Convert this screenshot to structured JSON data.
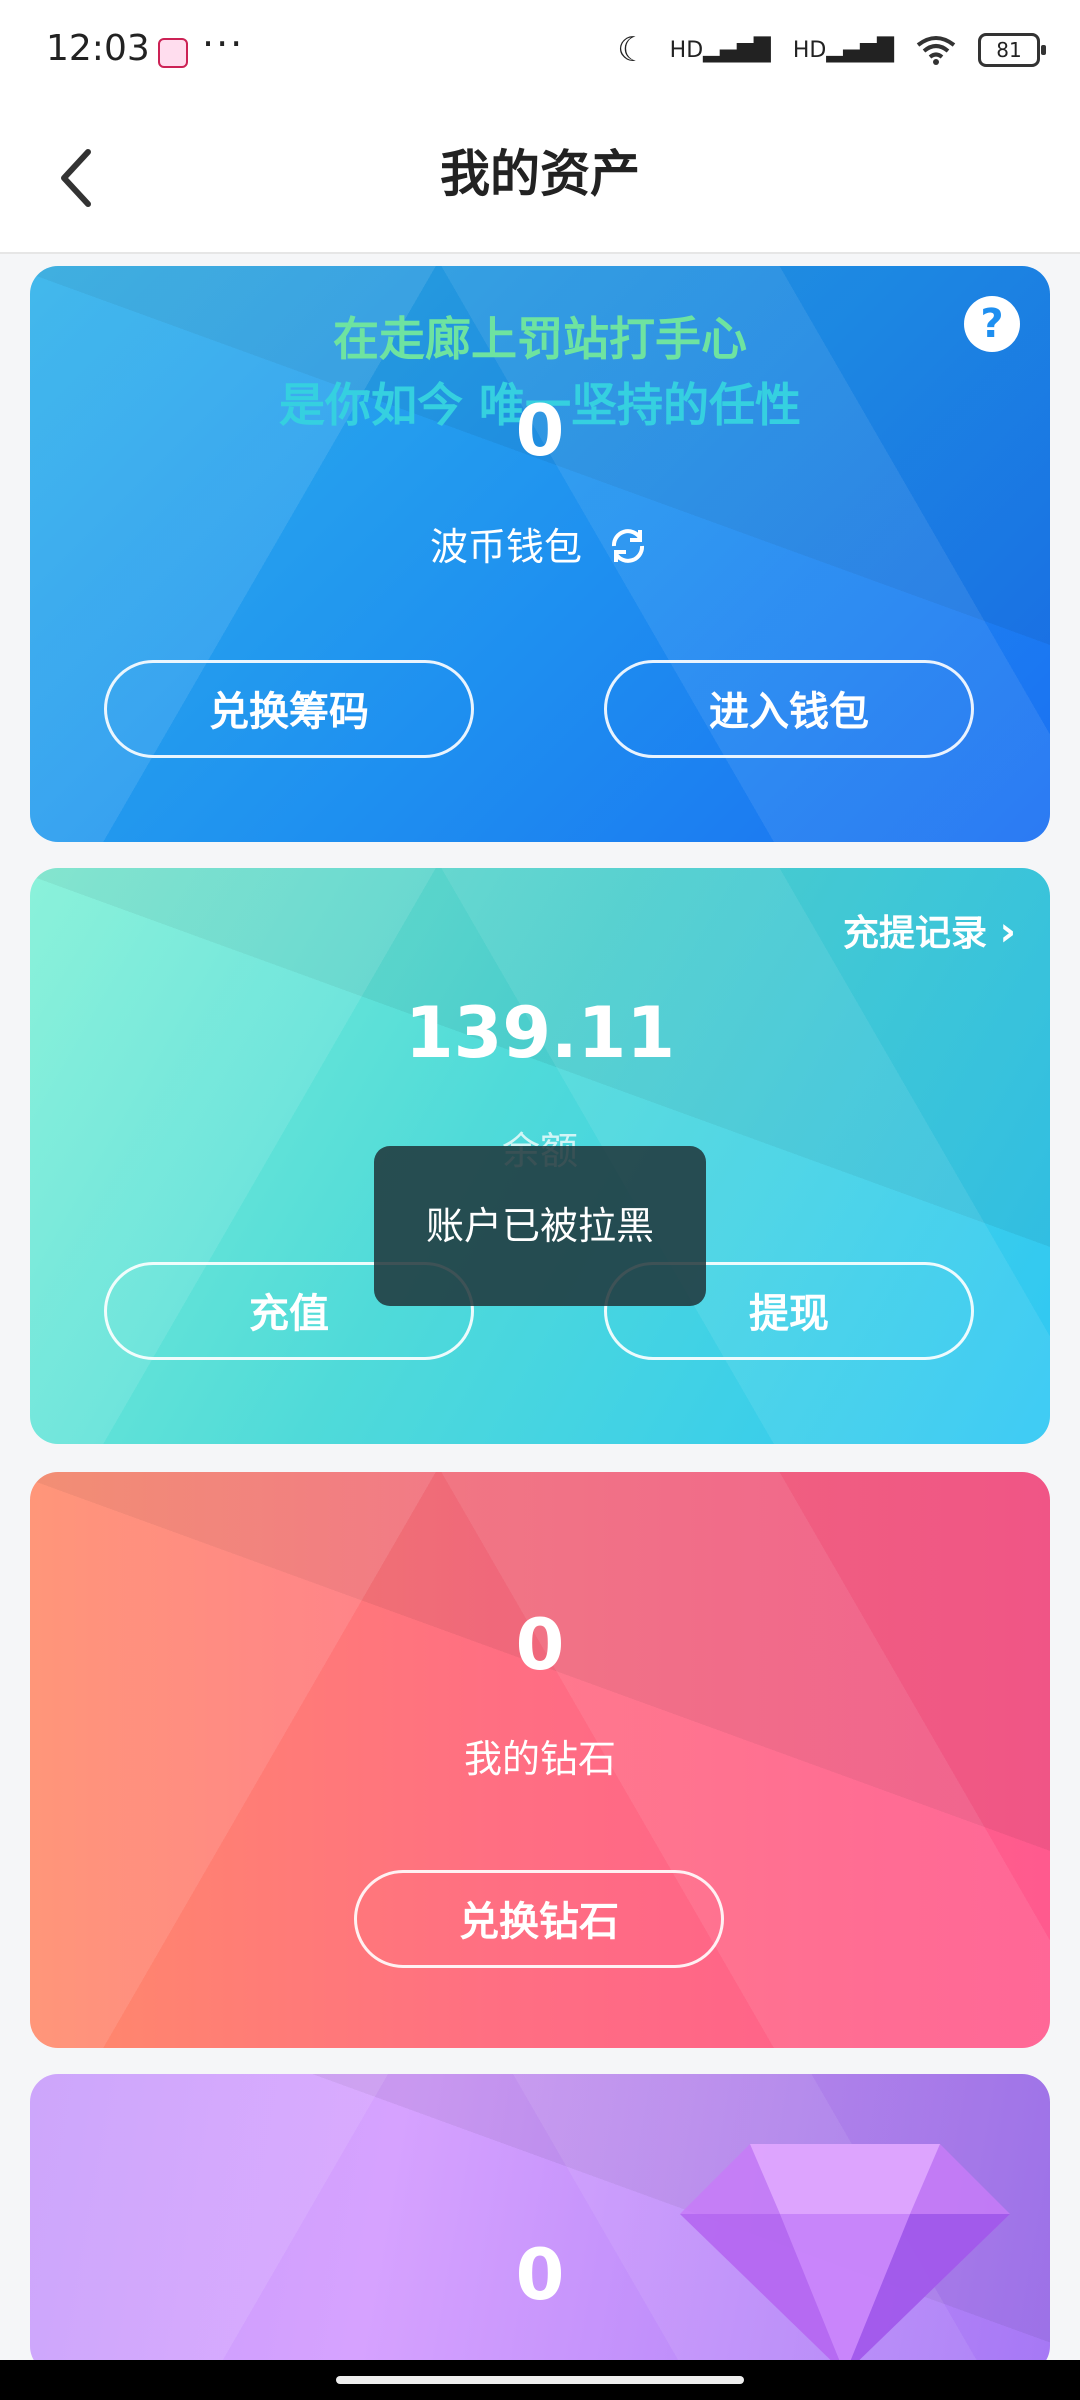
{
  "status_bar": {
    "time": "12:03",
    "more": "···",
    "network_1": "HD",
    "network_2": "HD",
    "battery": "81"
  },
  "nav": {
    "title": "我的资产"
  },
  "wallet_card": {
    "lyric_line_1": "在走廊上罚站打手心",
    "lyric_line_2": "是你如今 唯一坚持的任性",
    "amount": "0",
    "label": "波币钱包",
    "btn_exchange": "兑换筹码",
    "btn_enter": "进入钱包"
  },
  "balance_card": {
    "record_link": "充提记录",
    "amount": "139.11",
    "label": "余额",
    "btn_recharge": "充值",
    "btn_withdraw": "提现"
  },
  "toast": {
    "text": "账户已被拉黑"
  },
  "diamond_card": {
    "amount": "0",
    "label": "我的钻石",
    "btn_exchange": "兑换钻石"
  },
  "gem_card": {
    "amount": "0"
  },
  "colors": {
    "wallet": "#1e8ff0",
    "balance": "#4fdad9",
    "diamond": "#ff6f82",
    "gem": "#c79cfb"
  }
}
